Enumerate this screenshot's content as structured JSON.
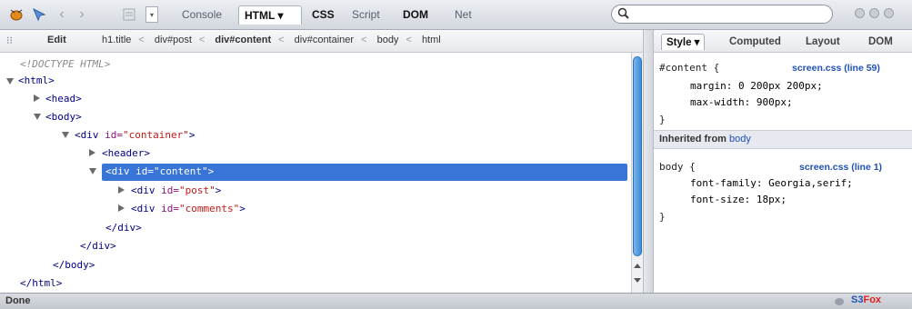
{
  "toolbar": {
    "tabs": [
      "Console",
      "HTML ▾",
      "CSS",
      "Script",
      "DOM",
      "Net"
    ],
    "search_placeholder": "",
    "icons": [
      "firebug-icon",
      "inspect-icon",
      "back-icon",
      "forward-icon",
      "layout-icon",
      "menu-icon"
    ]
  },
  "breadcrumb": {
    "edit_label": "Edit",
    "items": [
      "h1.title",
      "div#post",
      "div#content",
      "div#container",
      "body",
      "html"
    ]
  },
  "tree": {
    "doctype": "<!DOCTYPE HTML>",
    "html_open": "<html>",
    "head": "<head>",
    "body_open": "<body>",
    "div_open": "<div ",
    "id_attr": "id=",
    "container_val": "\"container\"",
    "header": "<header>",
    "content_val": "\"content\"",
    "post_val": "\"post\"",
    "comments_val": "\"comments\"",
    "tag_close": ">",
    "div_close": "</div>",
    "body_close": "</body>",
    "html_close": "</html>"
  },
  "side": {
    "tabs": [
      "Style ▾",
      "Computed",
      "Layout",
      "DOM"
    ],
    "rule1": {
      "selector": "#content {",
      "source": "screen.css (line 59)",
      "decls": [
        "margin: 0 200px 200px;",
        "max-width: 900px;"
      ],
      "close": "}"
    },
    "inherited_label": "Inherited from",
    "inherited_link": "body",
    "rule2": {
      "selector": "body {",
      "source": "screen.css (line 1)",
      "decls": [
        "font-family: Georgia,serif;",
        "font-size: 18px;"
      ],
      "close": "}"
    }
  },
  "status": {
    "text": "Done",
    "logo": "S3Fox"
  },
  "colors": {
    "selection": "#3875d7",
    "tag": "#000088",
    "attr": "#881280",
    "value": "#c41a16",
    "link": "#1f50b8"
  }
}
